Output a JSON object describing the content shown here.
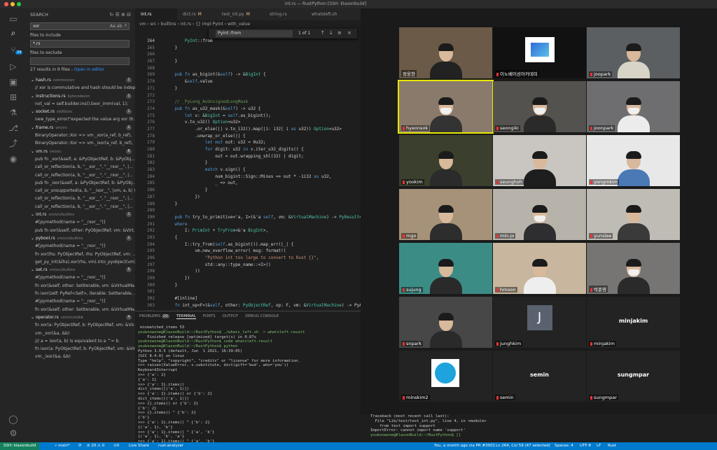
{
  "window": {
    "title": "int.rs — RustPython [SSH: klaxonbuild]"
  },
  "activity": [
    {
      "name": "explorer-icon",
      "glyph": "▭"
    },
    {
      "name": "search-icon",
      "glyph": "⌕"
    },
    {
      "name": "source-control-icon",
      "glyph": "⑂",
      "badge": "24"
    },
    {
      "name": "run-debug-icon",
      "glyph": "▷"
    },
    {
      "name": "remote-explorer-icon",
      "glyph": "▣"
    },
    {
      "name": "extensions-icon",
      "glyph": "⊞"
    },
    {
      "name": "testing-icon",
      "glyph": "⚗"
    },
    {
      "name": "git-graph-icon",
      "glyph": "⎇"
    },
    {
      "name": "live-share-icon",
      "glyph": "⤴"
    },
    {
      "name": "github-icon",
      "glyph": "◉"
    },
    {
      "name": "accounts-icon",
      "glyph": "◯"
    },
    {
      "name": "settings-gear-icon",
      "glyph": "⚙"
    }
  ],
  "search": {
    "title": "SEARCH",
    "query": "xor",
    "include_label": "files to include",
    "include_value": "*.rs",
    "exclude_label": "files to exclude",
    "exclude_value": "",
    "summary": "27 results in 9 files -",
    "open_in_editor": "Open in editor",
    "results": [
      {
        "kind": "file",
        "label": "hash.rs",
        "dir": "common/src",
        "count": "1"
      },
      {
        "kind": "match",
        "label": "// xor is commutative and hash should be indep..."
      },
      {
        "kind": "file",
        "label": "instructions.rs",
        "dir": "bytecode/src",
        "count": "1"
      },
      {
        "kind": "match",
        "label": "not_val = self.builder.ins().bxor_imm(val, 1);"
      },
      {
        "kind": "file",
        "label": "socket.rs",
        "dir": "stdlib/src",
        "count": "1"
      },
      {
        "kind": "match",
        "label": "new_type_error(\"expected the value arg xor th..."
      },
      {
        "kind": "file",
        "label": "frame.rs",
        "dir": "vm/src",
        "count": "2"
      },
      {
        "kind": "match",
        "label": "BinaryOperator::Xor => vm._xor(a_ref, b_ref),"
      },
      {
        "kind": "match",
        "label": "BinaryOperator::Xor => vm._ixor(a_ref, b_ref),"
      },
      {
        "kind": "file",
        "label": "vm.rs",
        "dir": "vm/src",
        "count": "8"
      },
      {
        "kind": "match",
        "label": "pub fn _xor(&self, a: &PyObjectRef, b: &PyObj..."
      },
      {
        "kind": "match",
        "label": "call_or_reflection(a, b, \"__xor__\", \"__rxor__\", |..."
      },
      {
        "kind": "match",
        "label": "call_or_reflection(a, b, \"__xor__\", \"__rxor__\", |..."
      },
      {
        "kind": "match",
        "label": "pub fn _ixor(&self, a: &PyObjectRef, b: &PyObj..."
      },
      {
        "kind": "match",
        "label": "call_or_unsupported(a, b, \"__ixor__\", |vm, a, b| {"
      },
      {
        "kind": "match",
        "label": "call_or_reflection(a, b, \"__xor__\", \"__rxor__\", |..."
      },
      {
        "kind": "match",
        "label": "call_or_reflection(a, b, \"__xor__\", \"__rxor__\", |..."
      },
      {
        "kind": "file",
        "label": "int.rs",
        "dir": "vm/src/builtins",
        "count": "2"
      },
      {
        "kind": "match",
        "label": "#[pymethod(name = \"__rxor__\")]"
      },
      {
        "kind": "match",
        "label": "pub fn xor(&self, other: PyObjectRef, vm: &Virt..."
      },
      {
        "kind": "file",
        "label": "pybool.rs",
        "dir": "vm/src/builtins",
        "count": "2"
      },
      {
        "kind": "match",
        "label": "#[pymethod(name = \"__rxor__\")]"
      },
      {
        "kind": "match",
        "label": "fn xor(lhs: PyObjectRef, rhs: PyObjectRef, vm: ..."
      },
      {
        "kind": "match",
        "label": "get_py_int(&lhs).xor(rhs, vm).into_pyobject(vm)"
      },
      {
        "kind": "file",
        "label": "set.rs",
        "dir": "vm/src/builtins",
        "count": "5"
      },
      {
        "kind": "match",
        "label": "#[pymethod(name = \"__rxor__\")]"
      },
      {
        "kind": "match",
        "label": "fn xor(&self, other: SetIterable, vm: &VirtualMa..."
      },
      {
        "kind": "match",
        "label": "fn ixor(zelf: PyRef<Self>, iterable: SetIterable, ..."
      },
      {
        "kind": "match",
        "label": "#[pymethod(name = \"__rxor__\")]"
      },
      {
        "kind": "match",
        "label": "fn xor(&self, other: SetIterable, vm: &VirtualMa..."
      },
      {
        "kind": "file",
        "label": "operator.rs",
        "dir": "vm/src/stdlib",
        "count": "4"
      },
      {
        "kind": "match",
        "label": "fn xor(a: PyObjectRef, b: PyObjectRef, vm: &Vir..."
      },
      {
        "kind": "match",
        "label": "vm._xor(&a, &b)"
      },
      {
        "kind": "match",
        "label": "/// a = ixor(a, b) is equivalent to a ^= b."
      },
      {
        "kind": "match",
        "label": "fn ixor(a: PyObjectRef, b: PyObjectRef, vm: &Vir..."
      },
      {
        "kind": "match",
        "label": "vm._ixor(&a, &b)"
      }
    ]
  },
  "editor": {
    "tabs": [
      {
        "label": "int.rs",
        "mod": "",
        "active": true
      },
      {
        "label": "dict.rs",
        "mod": "M",
        "active": false
      },
      {
        "label": "test_int.py",
        "mod": "M",
        "active": false
      },
      {
        "label": "string.rs",
        "mod": "",
        "active": false
      },
      {
        "label": "whatsleft.sh",
        "mod": "",
        "active": false
      }
    ],
    "breadcrumb": "vm › src › builtins › int.rs › {} impl PyInt › with_value",
    "find": {
      "query": "PyInt::from",
      "count": "1 of 1"
    },
    "lines": [
      {
        "n": "264",
        "t": "        PyInt::from"
      },
      {
        "n": "265",
        "t": "    }"
      },
      {
        "n": "266",
        "t": "    "
      },
      {
        "n": "267",
        "t": "    }"
      },
      {
        "n": "268",
        "t": ""
      },
      {
        "n": "269",
        "t": "    pub fn as_bigint(&self) -> &BigInt {"
      },
      {
        "n": "270",
        "t": "        &self.value"
      },
      {
        "n": "271",
        "t": "    }"
      },
      {
        "n": "272",
        "t": ""
      },
      {
        "n": "273",
        "t": "    // _PyLong_AsUnsignedLongMask"
      },
      {
        "n": "274",
        "t": "    pub fn as_u32_mask(&self) -> u32 {"
      },
      {
        "n": "275",
        "t": "        let v: &BigInt = self.as_bigint();"
      },
      {
        "n": "276",
        "t": "        v.to_u32() Option<u32>"
      },
      {
        "n": "277",
        "t": "            .or_else(|| v.to_i32().map(|i: i32| i as u32)) Option<u32>"
      },
      {
        "n": "278",
        "t": "            .unwrap_or_else(|| {"
      },
      {
        "n": "279",
        "t": "                let mut out: u32 = 0u32;"
      },
      {
        "n": "280",
        "t": "                for digit: u32 in v.iter_u32_digits() {"
      },
      {
        "n": "281",
        "t": "                    out = out.wrapping_shl(32) | digit;"
      },
      {
        "n": "282",
        "t": "                }"
      },
      {
        "n": "283",
        "t": "                match v.sign() {"
      },
      {
        "n": "284",
        "t": "                    num_bigint::Sign::Minus => out * -1i32 as u32,"
      },
      {
        "n": "285",
        "t": "                    _ => out,"
      },
      {
        "n": "286",
        "t": "                }"
      },
      {
        "n": "287",
        "t": "            })"
      },
      {
        "n": "288",
        "t": "    }"
      },
      {
        "n": "289",
        "t": ""
      },
      {
        "n": "290",
        "t": "    pub fn try_to_primitive<'a, I>(&'a self, vm: &VirtualMachine) -> PyResult<I>"
      },
      {
        "n": "291",
        "t": "    where"
      },
      {
        "n": "292",
        "t": "        I: PrimInt + TryFrom<&'a BigInt>,"
      },
      {
        "n": "293",
        "t": "    {"
      },
      {
        "n": "294",
        "t": "        I::try_from(self.as_bigint()).map_err(|_| {"
      },
      {
        "n": "295",
        "t": "            vm.new_overflow_error( msg: format!("
      },
      {
        "n": "296",
        "t": "                \"Python int too large to convert to Rust {}\","
      },
      {
        "n": "297",
        "t": "                std::any::type_name::<I>()"
      },
      {
        "n": "298",
        "t": "            ))"
      },
      {
        "n": "299",
        "t": "        })"
      },
      {
        "n": "300",
        "t": "    }"
      },
      {
        "n": "301",
        "t": ""
      },
      {
        "n": "302",
        "t": "    #[inline]"
      },
      {
        "n": "303",
        "t": "    fn int_op<F>(&self, other: PyObjectRef, op: F, vm: &VirtualMachine) -> PyArith"
      },
      {
        "n": "304",
        "t": "    where"
      },
      {
        "n": "305",
        "t": "        F: Fn(&BigInt, &BigInt) -> BigInt,"
      },
      {
        "n": "306",
        "t": "    {"
      },
      {
        "n": "307",
        "t": "        let r: Option<BigInt> = other: PyObjectRef"
      },
      {
        "n": "308",
        "t": "            .payload_if_subclass::<PyInt>(vm) Option<&PyInt>"
      },
      {
        "n": "309",
        "t": "            .map(|other: &PyInt| op(&self.value, &other.value));"
      },
      {
        "n": "310",
        "t": "        PyArithmeticValue::from_option(r)"
      },
      {
        "n": "311",
        "t": "    }"
      }
    ]
  },
  "panel": {
    "tabs": [
      {
        "label": "PROBLEMS",
        "badge": "20",
        "active": false
      },
      {
        "label": "TERMINAL",
        "badge": "",
        "active": true
      },
      {
        "label": "PORTS",
        "badge": "",
        "active": false
      },
      {
        "label": "OUTPUT",
        "badge": "",
        "active": false
      },
      {
        "label": "DEBUG CONSOLE",
        "badge": "",
        "active": false
      }
    ],
    "terminal": [
      {
        "t": " mismatched_items 53",
        "p": false
      },
      {
        "t": "youknowone@KlaxonBuild:~/RustPython$ ./whats_left.sh  > whatsleft.result",
        "p": true
      },
      {
        "t": "    Finished release [optimized] target(s) in 0.07s",
        "p": false
      },
      {
        "t": "youknowone@KlaxonBuild:~/RustPython$ code whatsleft.result",
        "p": true
      },
      {
        "t": "youknowone@KlaxonBuild:~/RustPython$ python",
        "p": true
      },
      {
        "t": "Python 3.9.5 (default, Jun  1 2021, 16:39:05)",
        "p": false
      },
      {
        "t": "[GCC 8.4.0] on linux",
        "p": false
      },
      {
        "t": "Type \"help\", \"copyright\", \"credits\" or \"license\" for more information.",
        "p": false
      },
      {
        "t": ">>> raises(ValueError, s.substitute, dict(gift='bud', who='you'))",
        "p": false
      },
      {
        "t": "KeyboardInterrupt",
        "p": false
      },
      {
        "t": ">>> {'a': 1}",
        "p": false
      },
      {
        "t": "{'a': 1}",
        "p": false
      },
      {
        "t": ">>> {'a': 1}.items()",
        "p": false
      },
      {
        "t": "dict_items([('a', 1)])",
        "p": false
      },
      {
        "t": ">>> {'a': 1}.items() or {'b': 2}",
        "p": false
      },
      {
        "t": "dict_items([('a', 1)])",
        "p": false
      },
      {
        "t": ">>> {}.items() or {'b': 2}",
        "p": false
      },
      {
        "t": "{'b': 2}",
        "p": false
      },
      {
        "t": ">>> {}.items() ^ {'b': 2}",
        "p": false
      },
      {
        "t": "{'b'}",
        "p": false
      },
      {
        "t": ">>> {'a': 1}.items() ^ {'b': 2}",
        "p": false
      },
      {
        "t": "{('a', 1), 'b'}",
        "p": false
      },
      {
        "t": ">>> {'a': 1}.items() ^ {'a', 'b'}",
        "p": false
      },
      {
        "t": "{('a', 1), 'b', 'a'}",
        "p": false
      },
      {
        "t": ">>> {'a': 1}.items() ^ {'a', 'b'}",
        "p": false
      }
    ]
  },
  "zoom": {
    "tiles": [
      {
        "name": "정웅현",
        "kind": "person",
        "bg": "#6b5a48",
        "shirt": "#222",
        "mic": false,
        "active": false
      },
      {
        "name": "이노베이션아카데미",
        "kind": "logo",
        "bg": "#111111",
        "mic": true,
        "active": false
      },
      {
        "name": "joopark",
        "kind": "person",
        "bg": "#5b5f61",
        "shirt": "#d8d4c8",
        "mic": true,
        "active": false
      },
      {
        "name": "hyeonsok",
        "kind": "person-mask",
        "bg": "#8a7a6c",
        "shirt": "#333",
        "mic": true,
        "active": true
      },
      {
        "name": "seongiki",
        "kind": "person-mask",
        "bg": "#54524e",
        "shirt": "#2a2a2a",
        "mic": true,
        "active": false
      },
      {
        "name": "joonpark",
        "kind": "person-mask",
        "bg": "#6e6e70",
        "shirt": "#ececec",
        "mic": true,
        "active": false
      },
      {
        "name": "yookim",
        "kind": "person",
        "bg": "#3a3f2e",
        "shirt": "#2b2b2b",
        "mic": true,
        "active": false
      },
      {
        "name": "seunghoh",
        "kind": "person",
        "bg": "#c9c6c1",
        "shirt": "#1e1e1e",
        "mic": true,
        "active": false
      },
      {
        "name": "yongmkim",
        "kind": "person",
        "bg": "#e8e8e8",
        "shirt": "#4a79b5",
        "mic": true,
        "active": false
      },
      {
        "name": "mgo",
        "kind": "person",
        "bg": "#a69278",
        "shirt": "#2d2d2d",
        "mic": true,
        "active": false
      },
      {
        "name": "min-jo",
        "kind": "person-mask",
        "bg": "#b7b2aa",
        "shirt": "#2e2e30",
        "mic": true,
        "active": false
      },
      {
        "name": "yunslee",
        "kind": "person",
        "bg": "#bfbcb6",
        "shirt": "#3a3a3a",
        "mic": true,
        "active": false
      },
      {
        "name": "sujung",
        "kind": "person",
        "bg": "#3c8c86",
        "shirt": "#2a2a2a",
        "mic": true,
        "active": false
      },
      {
        "name": "hmoon",
        "kind": "person",
        "bg": "#c8b79e",
        "shirt": "#eeeeee",
        "mic": true,
        "active": false
      },
      {
        "name": "박준영",
        "kind": "person-mask",
        "bg": "#767574",
        "shirt": "#2a2a2a",
        "mic": true,
        "active": false
      },
      {
        "name": "snpark",
        "kind": "person",
        "bg": "#474747",
        "shirt": "#2a2a2a",
        "mic": true,
        "active": false
      },
      {
        "name": "junghkim",
        "kind": "initial",
        "bg": "#232323",
        "initial": "J",
        "mic": true,
        "active": false
      },
      {
        "name": "minjakim",
        "kind": "label",
        "bg": "#232323",
        "label": "minjakim",
        "mic": true,
        "active": false
      },
      {
        "name": "minskim2",
        "kind": "avatar",
        "bg": "#232323",
        "mic": true,
        "active": false
      },
      {
        "name": "semin",
        "kind": "label",
        "bg": "#232323",
        "label": "semin",
        "mic": true,
        "active": false
      },
      {
        "name": "sungmpar",
        "kind": "label",
        "bg": "#232323",
        "label": "sungmpar",
        "mic": true,
        "active": false
      }
    ],
    "terminal": [
      "Traceback (most recent call last):",
      "  File \"Lib/test/test_int.py\", line 4, in <module>",
      "    from test import support",
      "ImportError: cannot import name 'support'",
      "youknowone@KlaxonBuild:~/RustPython$ []"
    ]
  },
  "status": {
    "remote": "SSH: klaxonbuild",
    "branch": "main*",
    "sync": "⟳",
    "problems": "⊘ 20  ⚠ 0",
    "ports": "⊙0",
    "live_share": "Live Share",
    "analyzer": "rust-analyzer",
    "blame": "You, a month ago via PR #3001",
    "position": "Ln 264, Col 59 (47 selected)",
    "spaces": "Spaces: 4",
    "encoding": "UTF-8",
    "eol": "LF",
    "language": "Rust"
  }
}
